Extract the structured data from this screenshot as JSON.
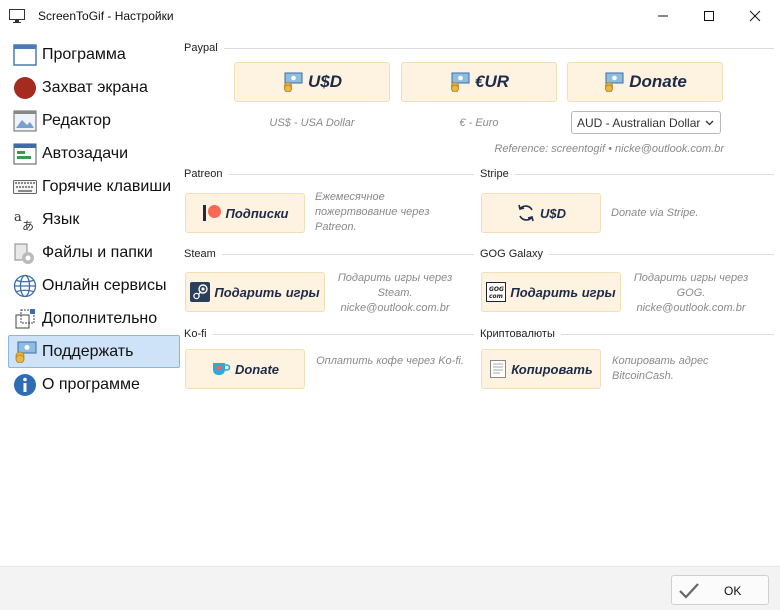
{
  "window": {
    "title": "ScreenToGif - Настройки"
  },
  "sidebar": {
    "items": [
      {
        "label": "Программа",
        "icon": "window-icon"
      },
      {
        "label": "Захват экрана",
        "icon": "record-icon"
      },
      {
        "label": "Редактор",
        "icon": "image-icon"
      },
      {
        "label": "Автозадачи",
        "icon": "tasks-icon"
      },
      {
        "label": "Горячие клавиши",
        "icon": "keyboard-icon"
      },
      {
        "label": "Язык",
        "icon": "language-icon"
      },
      {
        "label": "Файлы и папки",
        "icon": "folder-icon"
      },
      {
        "label": "Онлайн сервисы",
        "icon": "globe-icon"
      },
      {
        "label": "Дополнительно",
        "icon": "cube-icon"
      },
      {
        "label": "Поддержать",
        "icon": "donate-icon",
        "selected": true
      },
      {
        "label": "О программе",
        "icon": "info-icon"
      }
    ]
  },
  "paypal": {
    "heading": "Paypal",
    "usd_label": "U$D",
    "eur_label": "€UR",
    "donate_label": "Donate",
    "usd_note": "US$ - USA Dollar",
    "eur_note": "€ - Euro",
    "currency_selected": "AUD - Australian Dollar",
    "reference": "Reference: screentogif • nicke@outlook.com.br"
  },
  "patreon": {
    "heading": "Patreon",
    "button_label": "Подписки",
    "note": "Ежемесячное пожертвование через Patreon."
  },
  "stripe": {
    "heading": "Stripe",
    "button_label": "U$D",
    "note": "Donate via Stripe."
  },
  "steam": {
    "heading": "Steam",
    "button_label": "Подарить игры",
    "note": "Подарить игры через Steam. nicke@outlook.com.br"
  },
  "gog": {
    "heading": "GOG Galaxy",
    "button_label": "Подарить игры",
    "note": "Подарить игры через GOG. nicke@outlook.com.br"
  },
  "kofi": {
    "heading": "Ko-fi",
    "button_label": "Donate",
    "note": "Оплатить кофе через Ko-fi."
  },
  "crypto": {
    "heading": "Криптовалюты",
    "button_label": "Копировать",
    "note": "Копировать адрес BitcoinCash."
  },
  "footer": {
    "ok_label": "OK"
  },
  "colors": {
    "accent_button_bg": "#fdf3e0",
    "selected_item_bg": "#cfe3f8",
    "button_text": "#1d2b49"
  }
}
